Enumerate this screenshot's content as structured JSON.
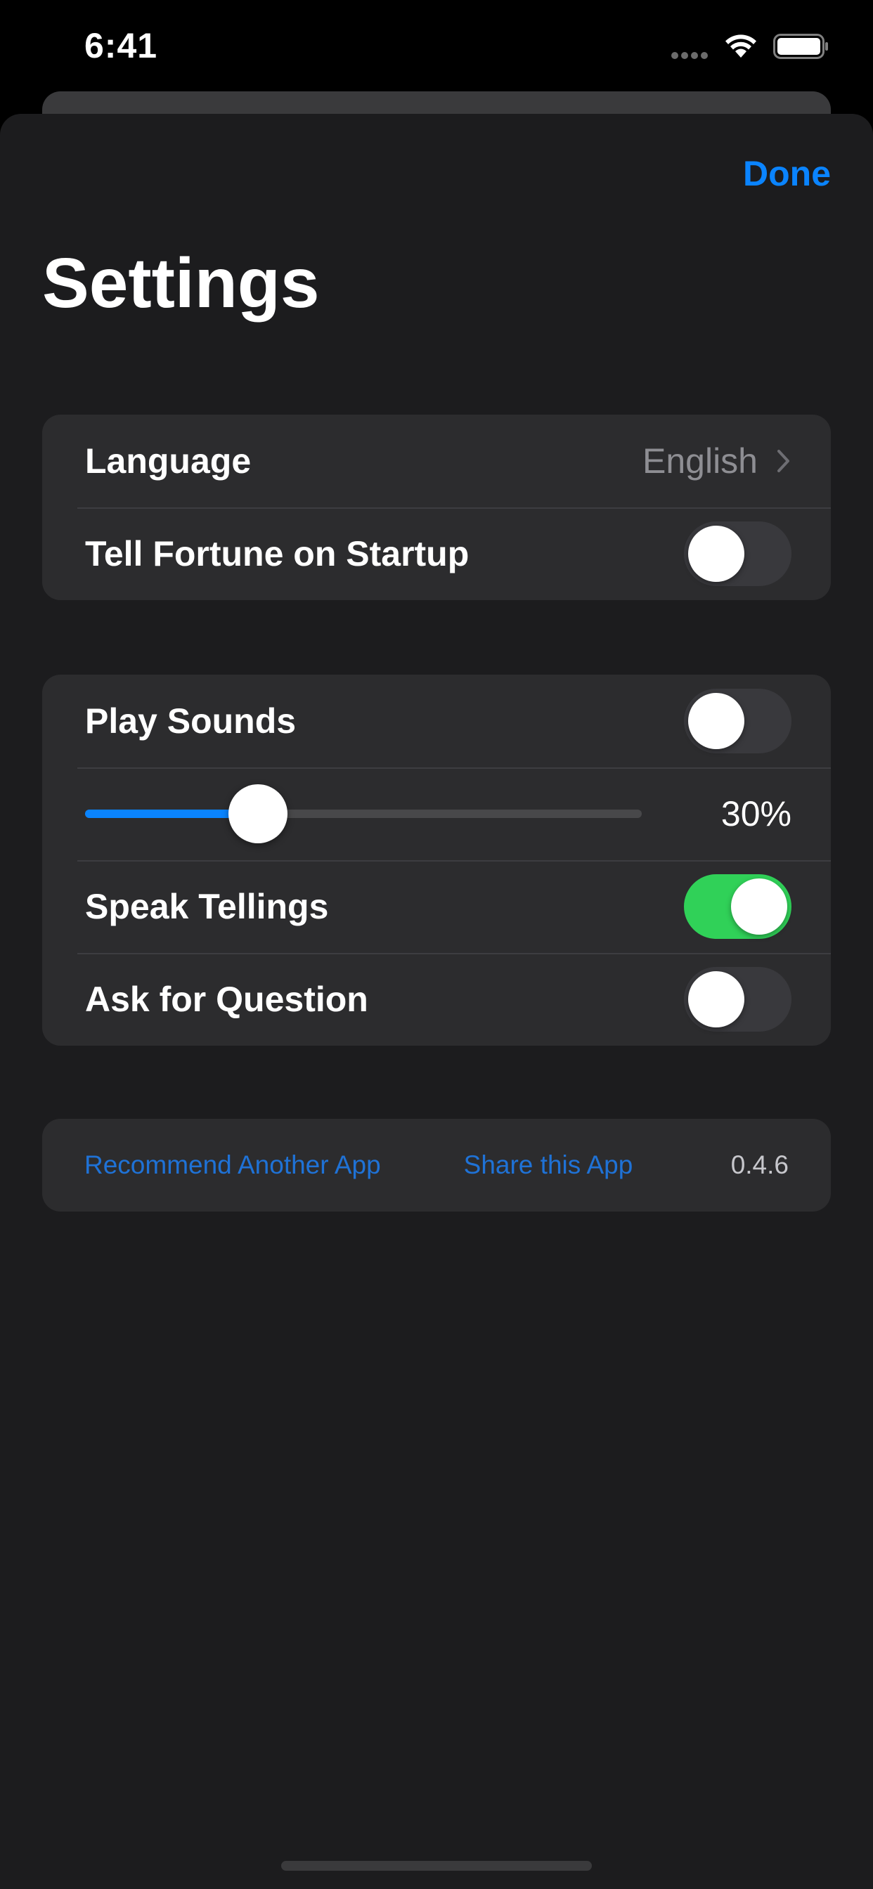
{
  "status_bar": {
    "time": "6:41"
  },
  "header": {
    "done_label": "Done",
    "title": "Settings"
  },
  "groups": {
    "general": {
      "language_label": "Language",
      "language_value": "English",
      "tell_fortune_label": "Tell Fortune on Startup",
      "tell_fortune_on": false
    },
    "sound": {
      "play_sounds_label": "Play Sounds",
      "play_sounds_on": false,
      "volume_percent": 30,
      "volume_label": "30%",
      "speak_tellings_label": "Speak Tellings",
      "speak_tellings_on": true,
      "ask_question_label": "Ask for Question",
      "ask_question_on": false
    },
    "footer": {
      "recommend_label": "Recommend Another App",
      "share_label": "Share this App",
      "version": "0.4.6"
    }
  },
  "colors": {
    "accent": "#0a84ff",
    "toggle_on": "#30d158",
    "toggle_off": "#39393d",
    "background": "#1c1c1e",
    "cell": "#2c2c2e"
  },
  "icons": {
    "wifi": "wifi-icon",
    "battery": "battery-icon",
    "chevron": "chevron-right-icon"
  }
}
